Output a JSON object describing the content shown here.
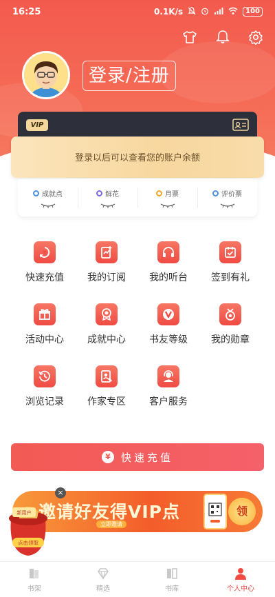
{
  "status_bar": {
    "time": "16:25",
    "network_speed": "0.1K/s",
    "battery": "100"
  },
  "header": {
    "login_label": "登录/注册"
  },
  "vip_card": {
    "badge": "VIP",
    "balance_hint": "登录以后可以查看您的账户余额"
  },
  "stats": [
    {
      "label": "成就点",
      "color": "#4a90e2"
    },
    {
      "label": "鲜花",
      "color": "#7b68ee"
    },
    {
      "label": "月票",
      "color": "#f5a623"
    },
    {
      "label": "评价票",
      "color": "#4a90e2"
    }
  ],
  "menu": [
    {
      "label": "快速充值",
      "icon": "yen-icon"
    },
    {
      "label": "我的订阅",
      "icon": "subscribe-icon"
    },
    {
      "label": "我的听台",
      "icon": "headphones-icon"
    },
    {
      "label": "签到有礼",
      "icon": "calendar-check-icon"
    },
    {
      "label": "活动中心",
      "icon": "gift-icon"
    },
    {
      "label": "成就中心",
      "icon": "medal-icon"
    },
    {
      "label": "书友等级",
      "icon": "level-v-icon"
    },
    {
      "label": "我的勋章",
      "icon": "badge-icon"
    },
    {
      "label": "浏览记录",
      "icon": "history-icon"
    },
    {
      "label": "作家专区",
      "icon": "writer-icon"
    },
    {
      "label": "客户服务",
      "icon": "customer-service-icon"
    }
  ],
  "recharge_button": {
    "label": "快速充值",
    "symbol": "¥"
  },
  "promo": {
    "title": "邀请好友得VIP点",
    "subtitle": "立即邀请",
    "claim": "领",
    "redbag_top": "新用户",
    "redbag_bottom": "点击领取",
    "close": "×"
  },
  "tabs": [
    {
      "label": "书架",
      "active": false
    },
    {
      "label": "精选",
      "active": false
    },
    {
      "label": "书库",
      "active": false
    },
    {
      "label": "个人中心",
      "active": true
    }
  ],
  "colors": {
    "primary": "#ef4b43",
    "gold": "#f7d79e",
    "dark_card": "#2d2f3b"
  }
}
